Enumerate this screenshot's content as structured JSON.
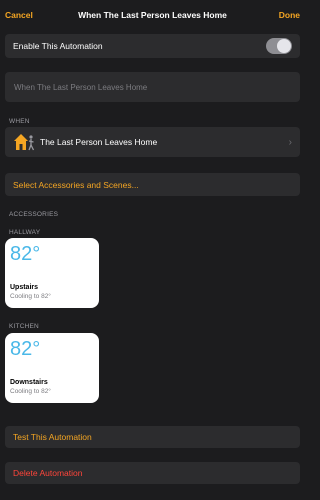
{
  "navbar": {
    "cancel_label": "Cancel",
    "title": "When The Last Person Leaves Home",
    "done_label": "Done"
  },
  "enable": {
    "label": "Enable This Automation",
    "on": true
  },
  "name_field": {
    "value": "When The Last Person Leaves Home"
  },
  "when": {
    "section_label": "WHEN",
    "trigger_label": "The Last Person Leaves Home",
    "icon": "home-person-leaving-icon"
  },
  "select_accessories": {
    "label": "Select Accessories and Scenes..."
  },
  "accessories": {
    "section_label": "ACCESSORIES",
    "rooms": [
      {
        "room_label": "HALLWAY",
        "tile": {
          "temp": "82°",
          "name": "Upstairs",
          "status": "Cooling to 82°"
        }
      },
      {
        "room_label": "KITCHEN",
        "tile": {
          "temp": "82°",
          "name": "Downstairs",
          "status": "Cooling to 82°"
        }
      }
    ]
  },
  "test": {
    "label": "Test This Automation"
  },
  "delete": {
    "label": "Delete Automation"
  },
  "colors": {
    "accent": "#f5a623",
    "destructive": "#ff453a",
    "temp": "#4ab8e8",
    "background": "#1c1c1e",
    "row": "#2c2c2e"
  }
}
